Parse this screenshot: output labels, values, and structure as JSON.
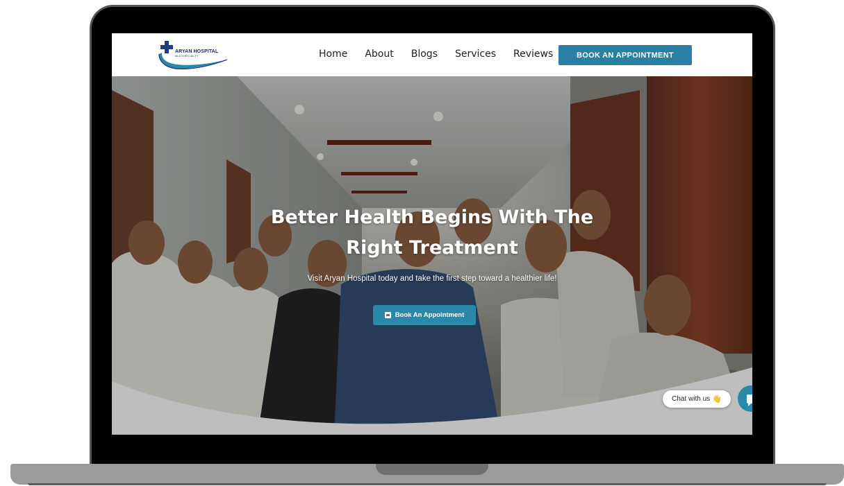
{
  "brand": {
    "name": "ARYAN HOSPITAL",
    "tagline": "MULTISPECIALITY"
  },
  "nav": {
    "links": [
      "Home",
      "About",
      "Blogs",
      "Services",
      "Reviews"
    ],
    "cta": "BOOK AN APPOINTMENT"
  },
  "hero": {
    "title_line1": "Better Health Begins With The",
    "title_line2": "Right Treatment",
    "subtitle": "Visit Aryan Hospital today and take the first step toward a healthier life!",
    "button": "Book An Appointment"
  },
  "chat": {
    "label": "Chat with us",
    "emoji": "👋"
  },
  "colors": {
    "accent": "#2a7fa5",
    "navy": "#18306b",
    "frame": "#000000",
    "base": "#9b9b9b"
  }
}
